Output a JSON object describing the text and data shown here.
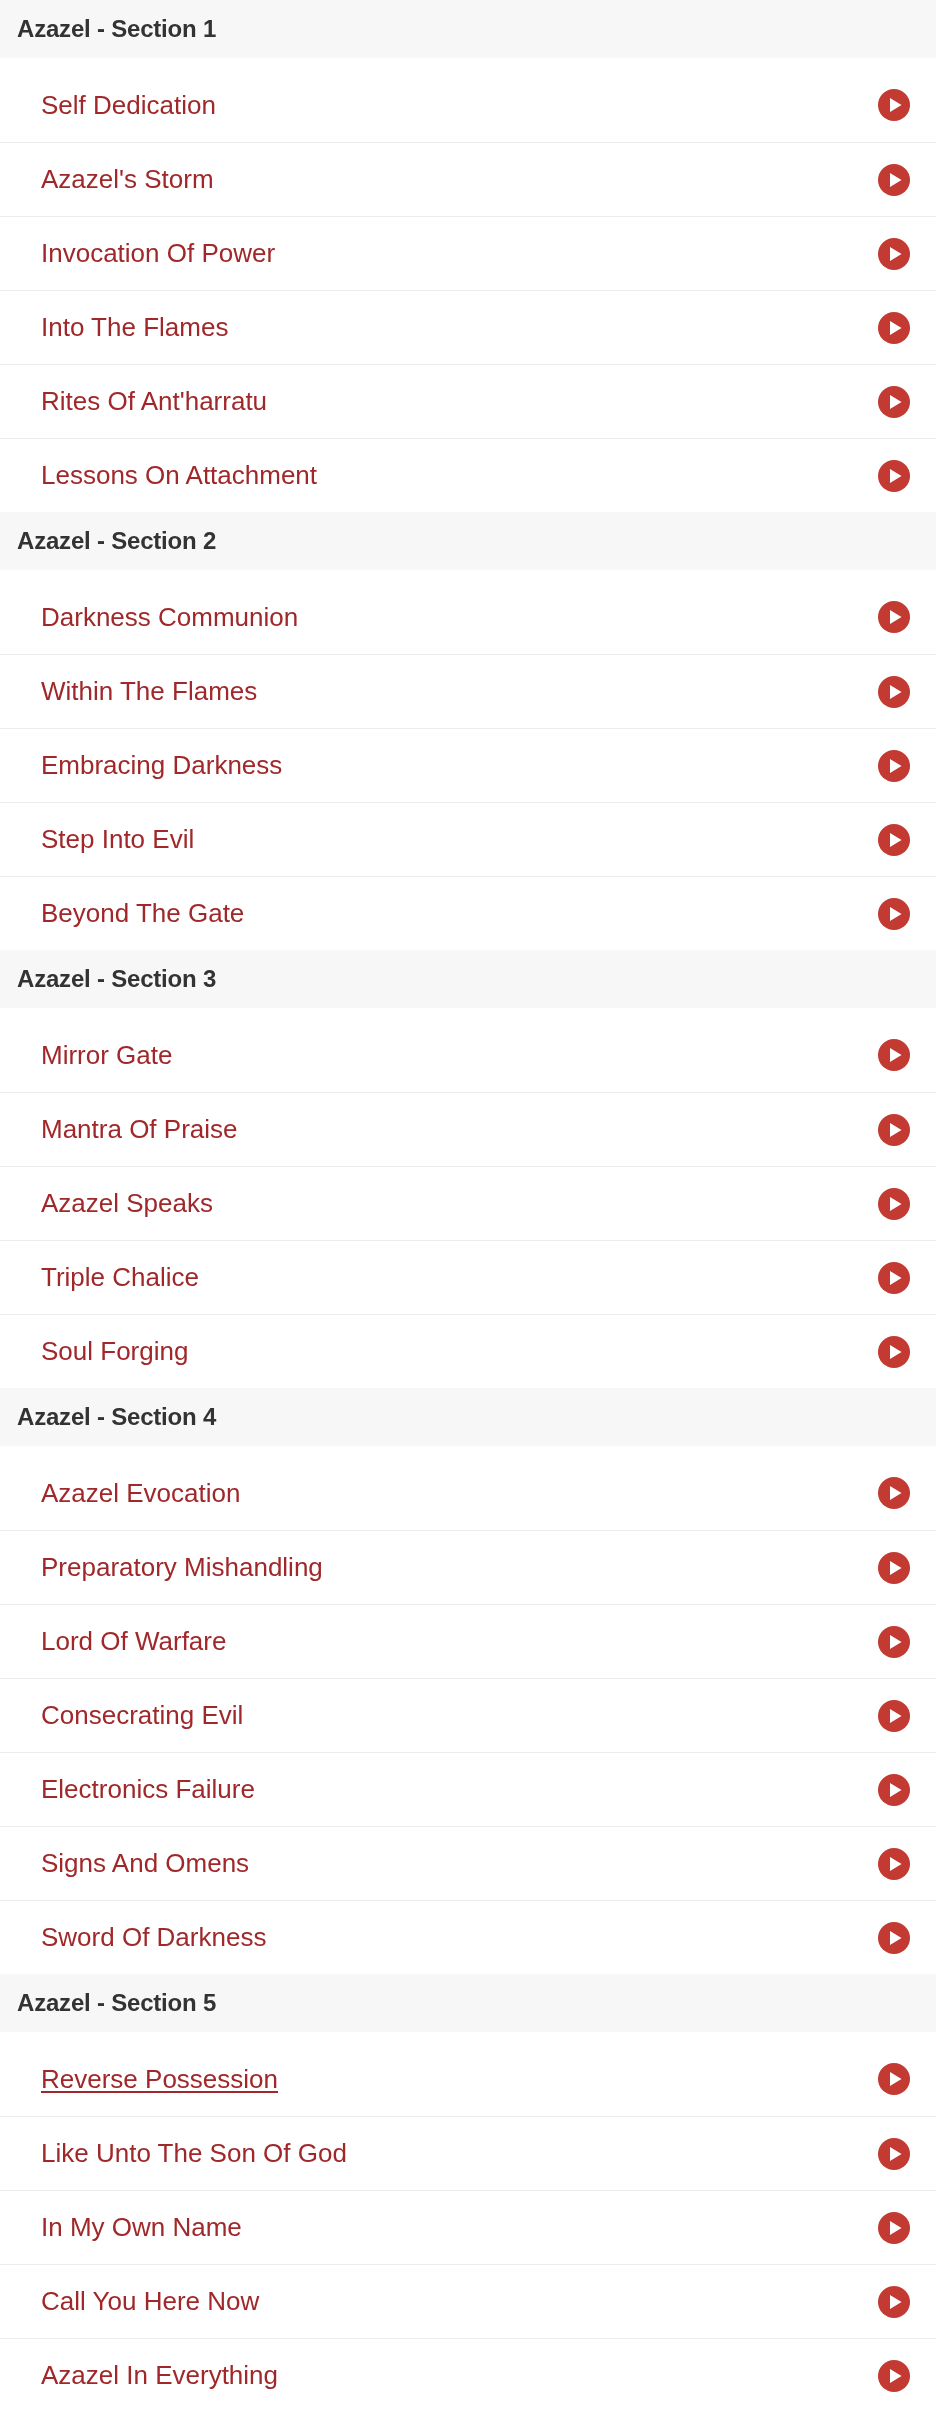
{
  "sections": [
    {
      "title": "Azazel - Section 1",
      "tracks": [
        {
          "title": "Self Dedication",
          "underlined": false
        },
        {
          "title": "Azazel's Storm",
          "underlined": false
        },
        {
          "title": "Invocation Of Power",
          "underlined": false
        },
        {
          "title": "Into The Flames",
          "underlined": false
        },
        {
          "title": "Rites Of Ant'harratu",
          "underlined": false
        },
        {
          "title": "Lessons On Attachment",
          "underlined": false
        }
      ]
    },
    {
      "title": "Azazel - Section 2",
      "tracks": [
        {
          "title": "Darkness Communion",
          "underlined": false
        },
        {
          "title": "Within The Flames",
          "underlined": false
        },
        {
          "title": "Embracing Darkness",
          "underlined": false
        },
        {
          "title": "Step Into Evil",
          "underlined": false
        },
        {
          "title": "Beyond The Gate",
          "underlined": false
        }
      ]
    },
    {
      "title": "Azazel - Section 3",
      "tracks": [
        {
          "title": "Mirror Gate",
          "underlined": false
        },
        {
          "title": "Mantra Of Praise",
          "underlined": false
        },
        {
          "title": "Azazel Speaks",
          "underlined": false
        },
        {
          "title": "Triple Chalice",
          "underlined": false
        },
        {
          "title": "Soul Forging",
          "underlined": false
        }
      ]
    },
    {
      "title": "Azazel - Section 4",
      "tracks": [
        {
          "title": "Azazel Evocation",
          "underlined": false
        },
        {
          "title": "Preparatory Mishandling",
          "underlined": false
        },
        {
          "title": "Lord Of Warfare",
          "underlined": false
        },
        {
          "title": "Consecrating Evil",
          "underlined": false
        },
        {
          "title": "Electronics Failure",
          "underlined": false
        },
        {
          "title": "Signs And Omens",
          "underlined": false
        },
        {
          "title": "Sword Of Darkness",
          "underlined": false
        }
      ]
    },
    {
      "title": "Azazel - Section 5",
      "tracks": [
        {
          "title": "Reverse Possession",
          "underlined": true
        },
        {
          "title": "Like Unto The Son Of God",
          "underlined": false
        },
        {
          "title": "In My Own Name",
          "underlined": false
        },
        {
          "title": "Call You Here Now",
          "underlined": false
        },
        {
          "title": "Azazel In Everything",
          "underlined": false
        }
      ]
    }
  ]
}
